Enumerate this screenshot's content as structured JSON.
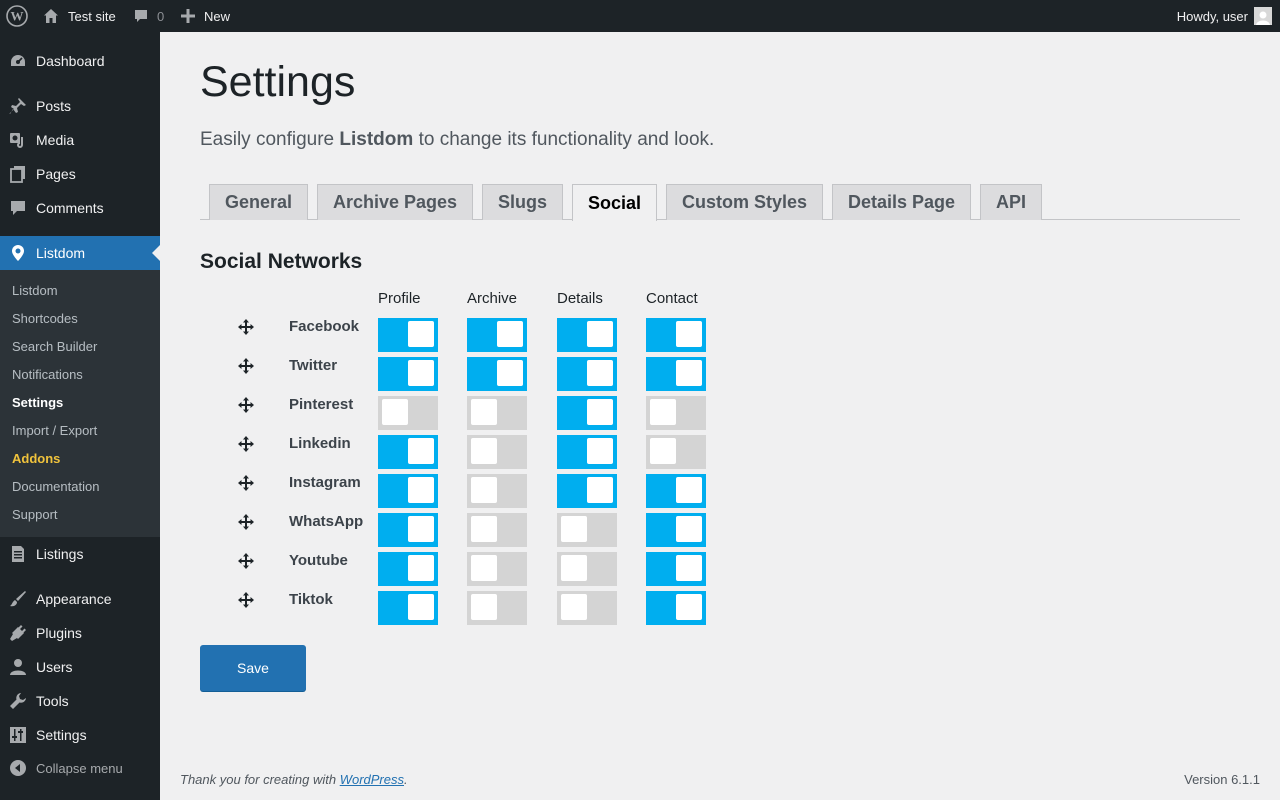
{
  "admin_bar": {
    "site_name": "Test site",
    "comments_count": "0",
    "new_label": "New",
    "howdy": "Howdy, user"
  },
  "sidebar": {
    "items": [
      {
        "label": "Dashboard",
        "icon": "dashboard-icon"
      },
      {
        "label": "Posts",
        "icon": "pushpin-icon"
      },
      {
        "label": "Media",
        "icon": "media-icon"
      },
      {
        "label": "Pages",
        "icon": "pages-icon"
      },
      {
        "label": "Comments",
        "icon": "comments-icon"
      },
      {
        "label": "Listdom",
        "icon": "location-pin-icon"
      },
      {
        "label": "Listings",
        "icon": "document-icon"
      },
      {
        "label": "Appearance",
        "icon": "paintbrush-icon"
      },
      {
        "label": "Plugins",
        "icon": "plug-icon"
      },
      {
        "label": "Users",
        "icon": "user-icon"
      },
      {
        "label": "Tools",
        "icon": "wrench-icon"
      },
      {
        "label": "Settings",
        "icon": "settings-sliders-icon"
      }
    ],
    "submenu": [
      "Listdom",
      "Shortcodes",
      "Search Builder",
      "Notifications",
      "Settings",
      "Import / Export",
      "Addons",
      "Documentation",
      "Support"
    ],
    "collapse_label": "Collapse menu"
  },
  "main": {
    "title": "Settings",
    "intro_before": "Easily configure ",
    "intro_brand": "Listdom",
    "intro_after": " to change its functionality and look.",
    "tabs": [
      "General",
      "Archive Pages",
      "Slugs",
      "Social",
      "Custom Styles",
      "Details Page",
      "API"
    ],
    "active_tab": "Social",
    "section_title": "Social Networks",
    "columns": [
      "Profile",
      "Archive",
      "Details",
      "Contact"
    ],
    "networks": [
      {
        "name": "Facebook",
        "toggles": [
          true,
          true,
          true,
          true
        ]
      },
      {
        "name": "Twitter",
        "toggles": [
          true,
          true,
          true,
          true
        ]
      },
      {
        "name": "Pinterest",
        "toggles": [
          false,
          false,
          true,
          false
        ]
      },
      {
        "name": "Linkedin",
        "toggles": [
          true,
          false,
          true,
          false
        ]
      },
      {
        "name": "Instagram",
        "toggles": [
          true,
          false,
          true,
          true
        ]
      },
      {
        "name": "WhatsApp",
        "toggles": [
          true,
          false,
          false,
          true
        ]
      },
      {
        "name": "Youtube",
        "toggles": [
          true,
          false,
          false,
          true
        ]
      },
      {
        "name": "Tiktok",
        "toggles": [
          true,
          false,
          false,
          true
        ]
      }
    ],
    "save_label": "Save"
  },
  "footer": {
    "thanks_before": "Thank you for creating with ",
    "thanks_link": "WordPress",
    "thanks_after": ".",
    "version": "Version 6.1.1"
  },
  "colors": {
    "toggle_on": "#00aeef",
    "toggle_off": "#d4d4d4",
    "accent": "#2271b1",
    "sidebar_bg": "#1d2327"
  }
}
